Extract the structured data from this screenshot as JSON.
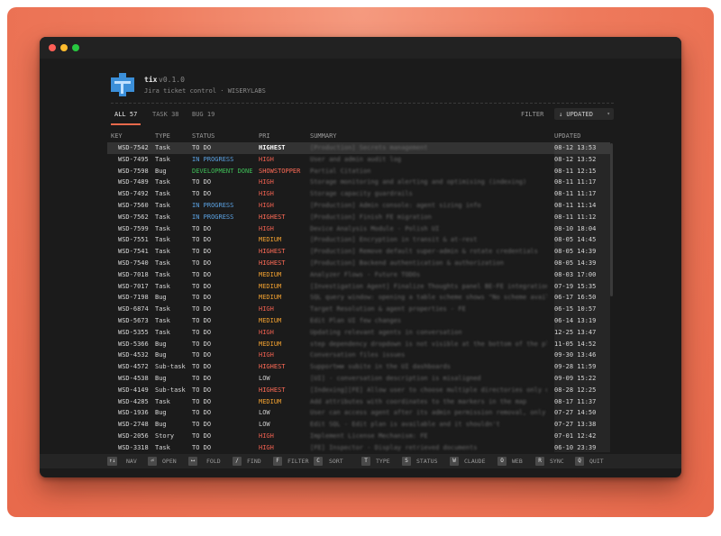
{
  "app": {
    "name": "tix",
    "version": "v0.1.0",
    "description": "Jira ticket control · WISERYLABS"
  },
  "tabs": [
    {
      "label": "ALL 57",
      "active": true
    },
    {
      "label": "TASK 38",
      "active": false
    },
    {
      "label": "BUG 19",
      "active": false
    }
  ],
  "filter_label": "FILTER",
  "sort": {
    "label": "↓ UPDATED",
    "arrow": "▾"
  },
  "columns": {
    "key": "KEY",
    "type": "TYPE",
    "status": "STATUS",
    "pri": "PRI",
    "summary": "SUMMARY",
    "updated": "UPDATED"
  },
  "rows": [
    {
      "key": "WSD-7542",
      "type": "Task",
      "status": "TO DO",
      "pri": "HIGHEST",
      "summary": "[Production] Secrets management",
      "updated": "08-12 13:53"
    },
    {
      "key": "WSD-7495",
      "type": "Task",
      "status": "IN PROGRESS",
      "pri": "HIGH",
      "summary": "User and admin audit log",
      "updated": "08-12 13:52"
    },
    {
      "key": "WSD-7598",
      "type": "Bug",
      "status": "DEVELOPMENT DONE",
      "pri": "SHOWSTOPPER",
      "summary": "Partial Citation",
      "updated": "08-11 12:15"
    },
    {
      "key": "WSD-7489",
      "type": "Task",
      "status": "TO DO",
      "pri": "HIGH",
      "summary": "Storage monitoring and alerting and optimising (indexing)",
      "updated": "08-11 11:17"
    },
    {
      "key": "WSD-7492",
      "type": "Task",
      "status": "TO DO",
      "pri": "HIGH",
      "summary": "Storage capacity guardrails",
      "updated": "08-11 11:17"
    },
    {
      "key": "WSD-7560",
      "type": "Task",
      "status": "IN PROGRESS",
      "pri": "HIGH",
      "summary": "[Production] Admin console: agent sizing info",
      "updated": "08-11 11:14"
    },
    {
      "key": "WSD-7562",
      "type": "Task",
      "status": "IN PROGRESS",
      "pri": "HIGHEST",
      "summary": "[Production] Finish FE migration",
      "updated": "08-11 11:12"
    },
    {
      "key": "WSD-7599",
      "type": "Task",
      "status": "TO DO",
      "pri": "HIGH",
      "summary": "Device Analysis Module - Polish UI",
      "updated": "08-10 18:04"
    },
    {
      "key": "WSD-7551",
      "type": "Task",
      "status": "TO DO",
      "pri": "MEDIUM",
      "summary": "[Production] Encryption in transit & at-rest",
      "updated": "08-05 14:45"
    },
    {
      "key": "WSD-7541",
      "type": "Task",
      "status": "TO DO",
      "pri": "HIGHEST",
      "summary": "[Production] Remove default super-admin & rotate credentials",
      "updated": "08-05 14:39"
    },
    {
      "key": "WSD-7540",
      "type": "Task",
      "status": "TO DO",
      "pri": "HIGHEST",
      "summary": "[Production] Backend authentication & authorization",
      "updated": "08-05 14:39"
    },
    {
      "key": "WSD-7018",
      "type": "Task",
      "status": "TO DO",
      "pri": "MEDIUM",
      "summary": "Analyzer Flows - Future TODOs",
      "updated": "08-03 17:00"
    },
    {
      "key": "WSD-7017",
      "type": "Task",
      "status": "TO DO",
      "pri": "MEDIUM",
      "summary": "[Investigation Agent] Finalize Thoughts panel BE-FE integration,",
      "updated": "07-19 15:35"
    },
    {
      "key": "WSD-7198",
      "type": "Bug",
      "status": "TO DO",
      "pri": "MEDIUM",
      "summary": "SQL query window: opening a table scheme shows \"No scheme avail",
      "updated": "06-17 16:50"
    },
    {
      "key": "WSD-6874",
      "type": "Task",
      "status": "TO DO",
      "pri": "HIGH",
      "summary": "Target Resolution & agent properties - FE",
      "updated": "06-15 10:57"
    },
    {
      "key": "WSD-5673",
      "type": "Task",
      "status": "TO DO",
      "pri": "MEDIUM",
      "summary": "Edit Plan UI few changes",
      "updated": "06-14 13:19"
    },
    {
      "key": "WSD-5355",
      "type": "Task",
      "status": "TO DO",
      "pri": "HIGH",
      "summary": "Updating relevant agents in conversation",
      "updated": "12-25 13:47"
    },
    {
      "key": "WSD-5366",
      "type": "Bug",
      "status": "TO DO",
      "pri": "MEDIUM",
      "summary": "step dependency dropdown is not visible at the bottom of the plan",
      "updated": "11-05 14:52"
    },
    {
      "key": "WSD-4532",
      "type": "Bug",
      "status": "TO DO",
      "pri": "HIGH",
      "summary": "Conversation files issues",
      "updated": "09-30 13:46"
    },
    {
      "key": "WSD-4572",
      "type": "Sub-task",
      "status": "TO DO",
      "pri": "HIGHEST",
      "summary": "Supportми subite in the UI dashboards",
      "updated": "09-28 11:59"
    },
    {
      "key": "WSD-4538",
      "type": "Bug",
      "status": "TO DO",
      "pri": "LOW",
      "summary": "[UI] - conversation description is misaligned",
      "updated": "09-09 15:22"
    },
    {
      "key": "WSD-4149",
      "type": "Sub-task",
      "status": "TO DO",
      "pri": "HIGHEST",
      "summary": "[Indexing][FE] Allow user to choose multiple directories only o",
      "updated": "08-28 12:25"
    },
    {
      "key": "WSD-4285",
      "type": "Task",
      "status": "TO DO",
      "pri": "MEDIUM",
      "summary": "Add attributes with coordinates to the markers in the map",
      "updated": "08-17 11:37"
    },
    {
      "key": "WSD-1936",
      "type": "Bug",
      "status": "TO DO",
      "pri": "LOW",
      "summary": "User can access agent after its admin permission removal, only",
      "updated": "07-27 14:50"
    },
    {
      "key": "WSD-2748",
      "type": "Bug",
      "status": "TO DO",
      "pri": "LOW",
      "summary": "Edit SQL - Edit plan is available and it shouldn't",
      "updated": "07-27 13:38"
    },
    {
      "key": "WSD-2056",
      "type": "Story",
      "status": "TO DO",
      "pri": "HIGH",
      "summary": "Implement License Mechanism: FE",
      "updated": "07-01 12:42"
    },
    {
      "key": "WSD-3318",
      "type": "Task",
      "status": "TO DO",
      "pri": "HIGH",
      "summary": "[FE] Inspector - Display retrieved documents",
      "updated": "06-10 23:39"
    }
  ],
  "shortcuts": [
    {
      "key": "↑↓",
      "label": "NAV"
    },
    {
      "key": "⏎",
      "label": "OPEN"
    },
    {
      "key": "⟷",
      "label": "FOLD"
    },
    {
      "key": "/",
      "label": "FIND"
    },
    {
      "key": "F",
      "label": "FILTER"
    },
    {
      "key": "C",
      "label": "SORT"
    },
    {
      "key": "T",
      "label": "TYPE"
    },
    {
      "key": "S",
      "label": "STATUS"
    },
    {
      "key": "W",
      "label": "CLAUDE"
    },
    {
      "key": "O",
      "label": "WEB"
    },
    {
      "key": "R",
      "label": "SYNC"
    },
    {
      "key": "Q",
      "label": "QUIT"
    }
  ],
  "colors": {
    "accent": "#e8694b",
    "in_progress": "#5aa0e0",
    "dev_done": "#3fbf58",
    "highest": "#ff6b57",
    "high": "#f06050",
    "medium": "#f0a030",
    "logo": "#3b8fd9"
  }
}
